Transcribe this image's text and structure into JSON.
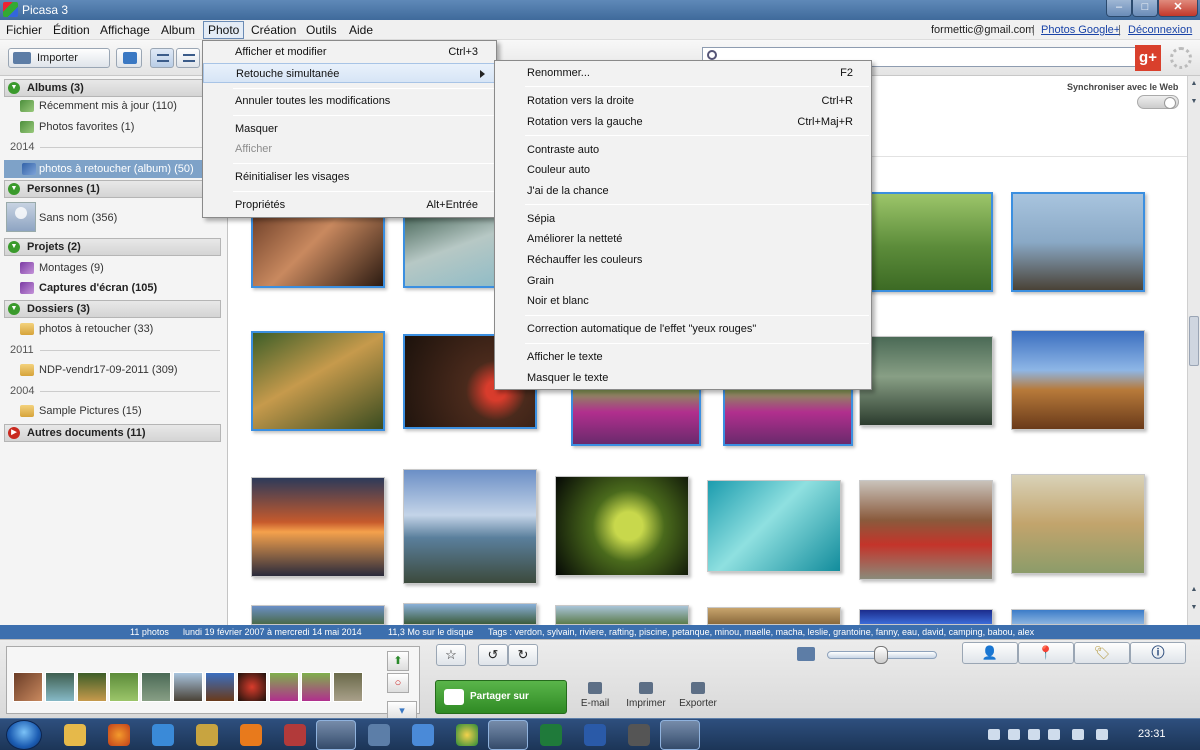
{
  "window": {
    "title": "Picasa 3",
    "min": "–",
    "max": "□",
    "close": "✕"
  },
  "menubar": {
    "items": [
      "Fichier",
      "Édition",
      "Affichage",
      "Album",
      "Photo",
      "Création",
      "Outils",
      "Aide"
    ],
    "account_email": "formettic@gmail.com",
    "separator": "|",
    "google_photos_link": "Photos Google+",
    "logout_link": "Déconnexion"
  },
  "toolbar": {
    "import_label": "Importer",
    "gplus": "g+"
  },
  "sidebar": {
    "albums_header": "Albums (3)",
    "albums": [
      "Récemment mis à jour (110)",
      "Photos favorites (1)"
    ],
    "year_2014": "2014",
    "selected_album": "photos à retoucher (album) (50)",
    "people_header": "Personnes (1)",
    "people": [
      "Sans nom (356)"
    ],
    "projects_header": "Projets (2)",
    "projects": [
      "Montages (9)",
      "Captures d'écran (105)"
    ],
    "folders_header": "Dossiers (3)",
    "folder_1": "photos à retoucher (33)",
    "year_2011": "2011",
    "folder_2": "NDP-vendr17-09-2011 (309)",
    "year_2004": "2004",
    "folder_3": "Sample Pictures (15)",
    "other_header": "Autres documents (11)"
  },
  "main": {
    "sync_label": "Synchroniser avec le Web"
  },
  "photo_menu": {
    "items": [
      {
        "label": "Afficher et modifier",
        "shortcut": "Ctrl+3"
      },
      {
        "label": "Retouche simultanée",
        "shortcut": ""
      },
      {
        "label": "Annuler toutes les modifications",
        "shortcut": ""
      },
      {
        "label": "Masquer",
        "shortcut": ""
      },
      {
        "label": "Afficher",
        "shortcut": ""
      },
      {
        "label": "Réinitialiser les visages",
        "shortcut": ""
      },
      {
        "label": "Propriétés",
        "shortcut": "Alt+Entrée"
      }
    ]
  },
  "batch_menu": {
    "items": [
      {
        "label": "Renommer...",
        "shortcut": "F2"
      },
      {
        "label": "Rotation vers la droite",
        "shortcut": "Ctrl+R"
      },
      {
        "label": "Rotation vers la gauche",
        "shortcut": "Ctrl+Maj+R"
      },
      {
        "label": "Contraste auto",
        "shortcut": ""
      },
      {
        "label": "Couleur auto",
        "shortcut": ""
      },
      {
        "label": "J'ai de la chance",
        "shortcut": ""
      },
      {
        "label": "Sépia",
        "shortcut": ""
      },
      {
        "label": "Améliorer la netteté",
        "shortcut": ""
      },
      {
        "label": "Réchauffer les couleurs",
        "shortcut": ""
      },
      {
        "label": "Grain",
        "shortcut": ""
      },
      {
        "label": "Noir et blanc",
        "shortcut": ""
      },
      {
        "label": "Correction automatique de l'effet \"yeux rouges\"",
        "shortcut": ""
      },
      {
        "label": "Afficher le texte",
        "shortcut": ""
      },
      {
        "label": "Masquer le texte",
        "shortcut": ""
      }
    ]
  },
  "statusbar": {
    "count": "11 photos",
    "dates": "lundi 19 février 2007 à mercredi 14 mai 2014",
    "size": "11,3 Mo sur le disque",
    "tags": "Tags : verdon, sylvain, riviere, rafting, piscine, petanque, minou, maelle, macha, leslie, grantoine, fanny, eau, david, camping, babou, alex"
  },
  "tray": {
    "share_label": "Partager sur Google+",
    "email_label": "E-mail",
    "print_label": "Imprimer",
    "export_label": "Exporter"
  },
  "taskbar": {
    "clock": "23:31"
  },
  "colors": {
    "accent": "#3c6fae",
    "selection": "#7ea2c8",
    "share_green": "#2f8a24"
  }
}
